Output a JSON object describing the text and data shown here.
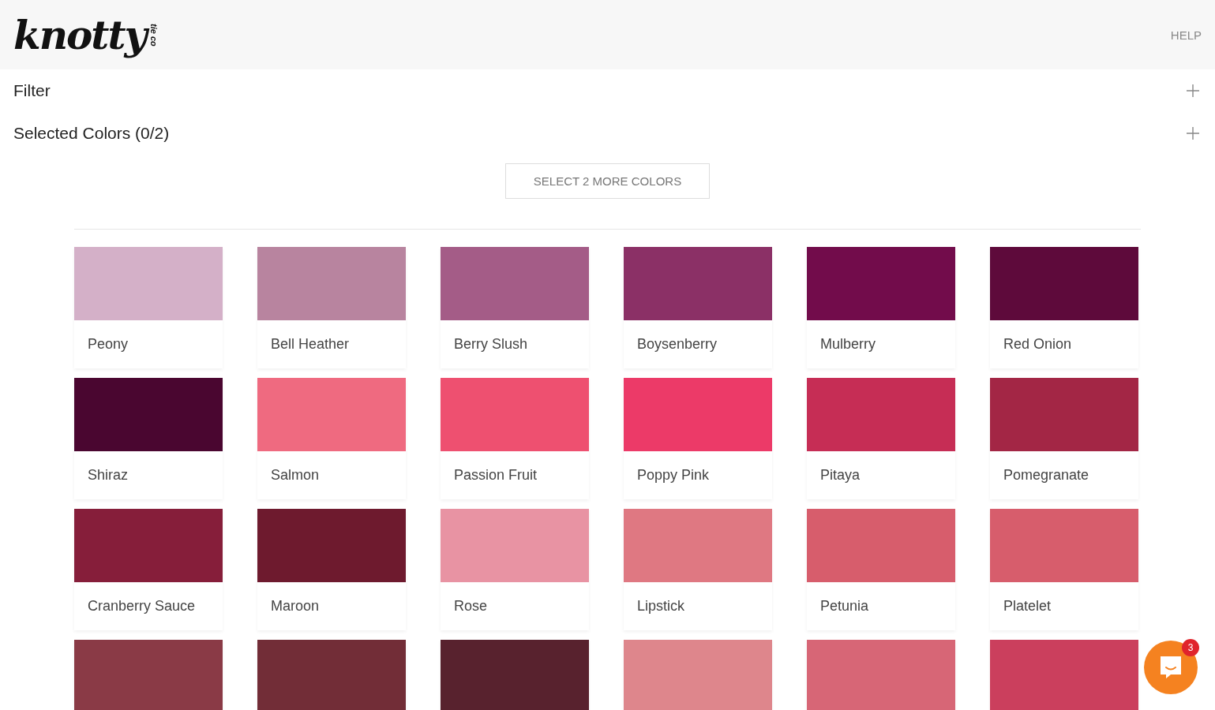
{
  "header": {
    "logo": "knotty",
    "logo_sub": "tie co",
    "help": "HELP"
  },
  "sections": [
    {
      "label": "Filter",
      "expanded": false
    },
    {
      "label": "Selected Colors (0/2)",
      "expanded": false
    }
  ],
  "select_button": "SELECT 2 MORE COLORS",
  "swatches": [
    {
      "name": "Peony",
      "color": "#d4b0c8"
    },
    {
      "name": "Bell Heather",
      "color": "#b8849f"
    },
    {
      "name": "Berry Slush",
      "color": "#a45c87"
    },
    {
      "name": "Boysenberry",
      "color": "#8b3066"
    },
    {
      "name": "Mulberry",
      "color": "#720c4b"
    },
    {
      "name": "Red Onion",
      "color": "#5e0a3b"
    },
    {
      "name": "Shiraz",
      "color": "#4a0630"
    },
    {
      "name": "Salmon",
      "color": "#ef6a80"
    },
    {
      "name": "Passion Fruit",
      "color": "#ee5070"
    },
    {
      "name": "Poppy Pink",
      "color": "#ec3a68"
    },
    {
      "name": "Pitaya",
      "color": "#c62d55"
    },
    {
      "name": "Pomegranate",
      "color": "#a32645"
    },
    {
      "name": "Cranberry Sauce",
      "color": "#861e3a"
    },
    {
      "name": "Maroon",
      "color": "#6e1a2e"
    },
    {
      "name": "Rose",
      "color": "#e893a3"
    },
    {
      "name": "Lipstick",
      "color": "#df7882"
    },
    {
      "name": "Petunia",
      "color": "#d75d6c"
    },
    {
      "name": "Platelet",
      "color": "#d75d6c"
    },
    {
      "color": "#8a3a46"
    },
    {
      "color": "#722d37"
    },
    {
      "color": "#58222e"
    },
    {
      "color": "#de868c"
    },
    {
      "color": "#d76676"
    },
    {
      "color": "#cb3f5d"
    }
  ],
  "chat": {
    "badge": "3"
  }
}
